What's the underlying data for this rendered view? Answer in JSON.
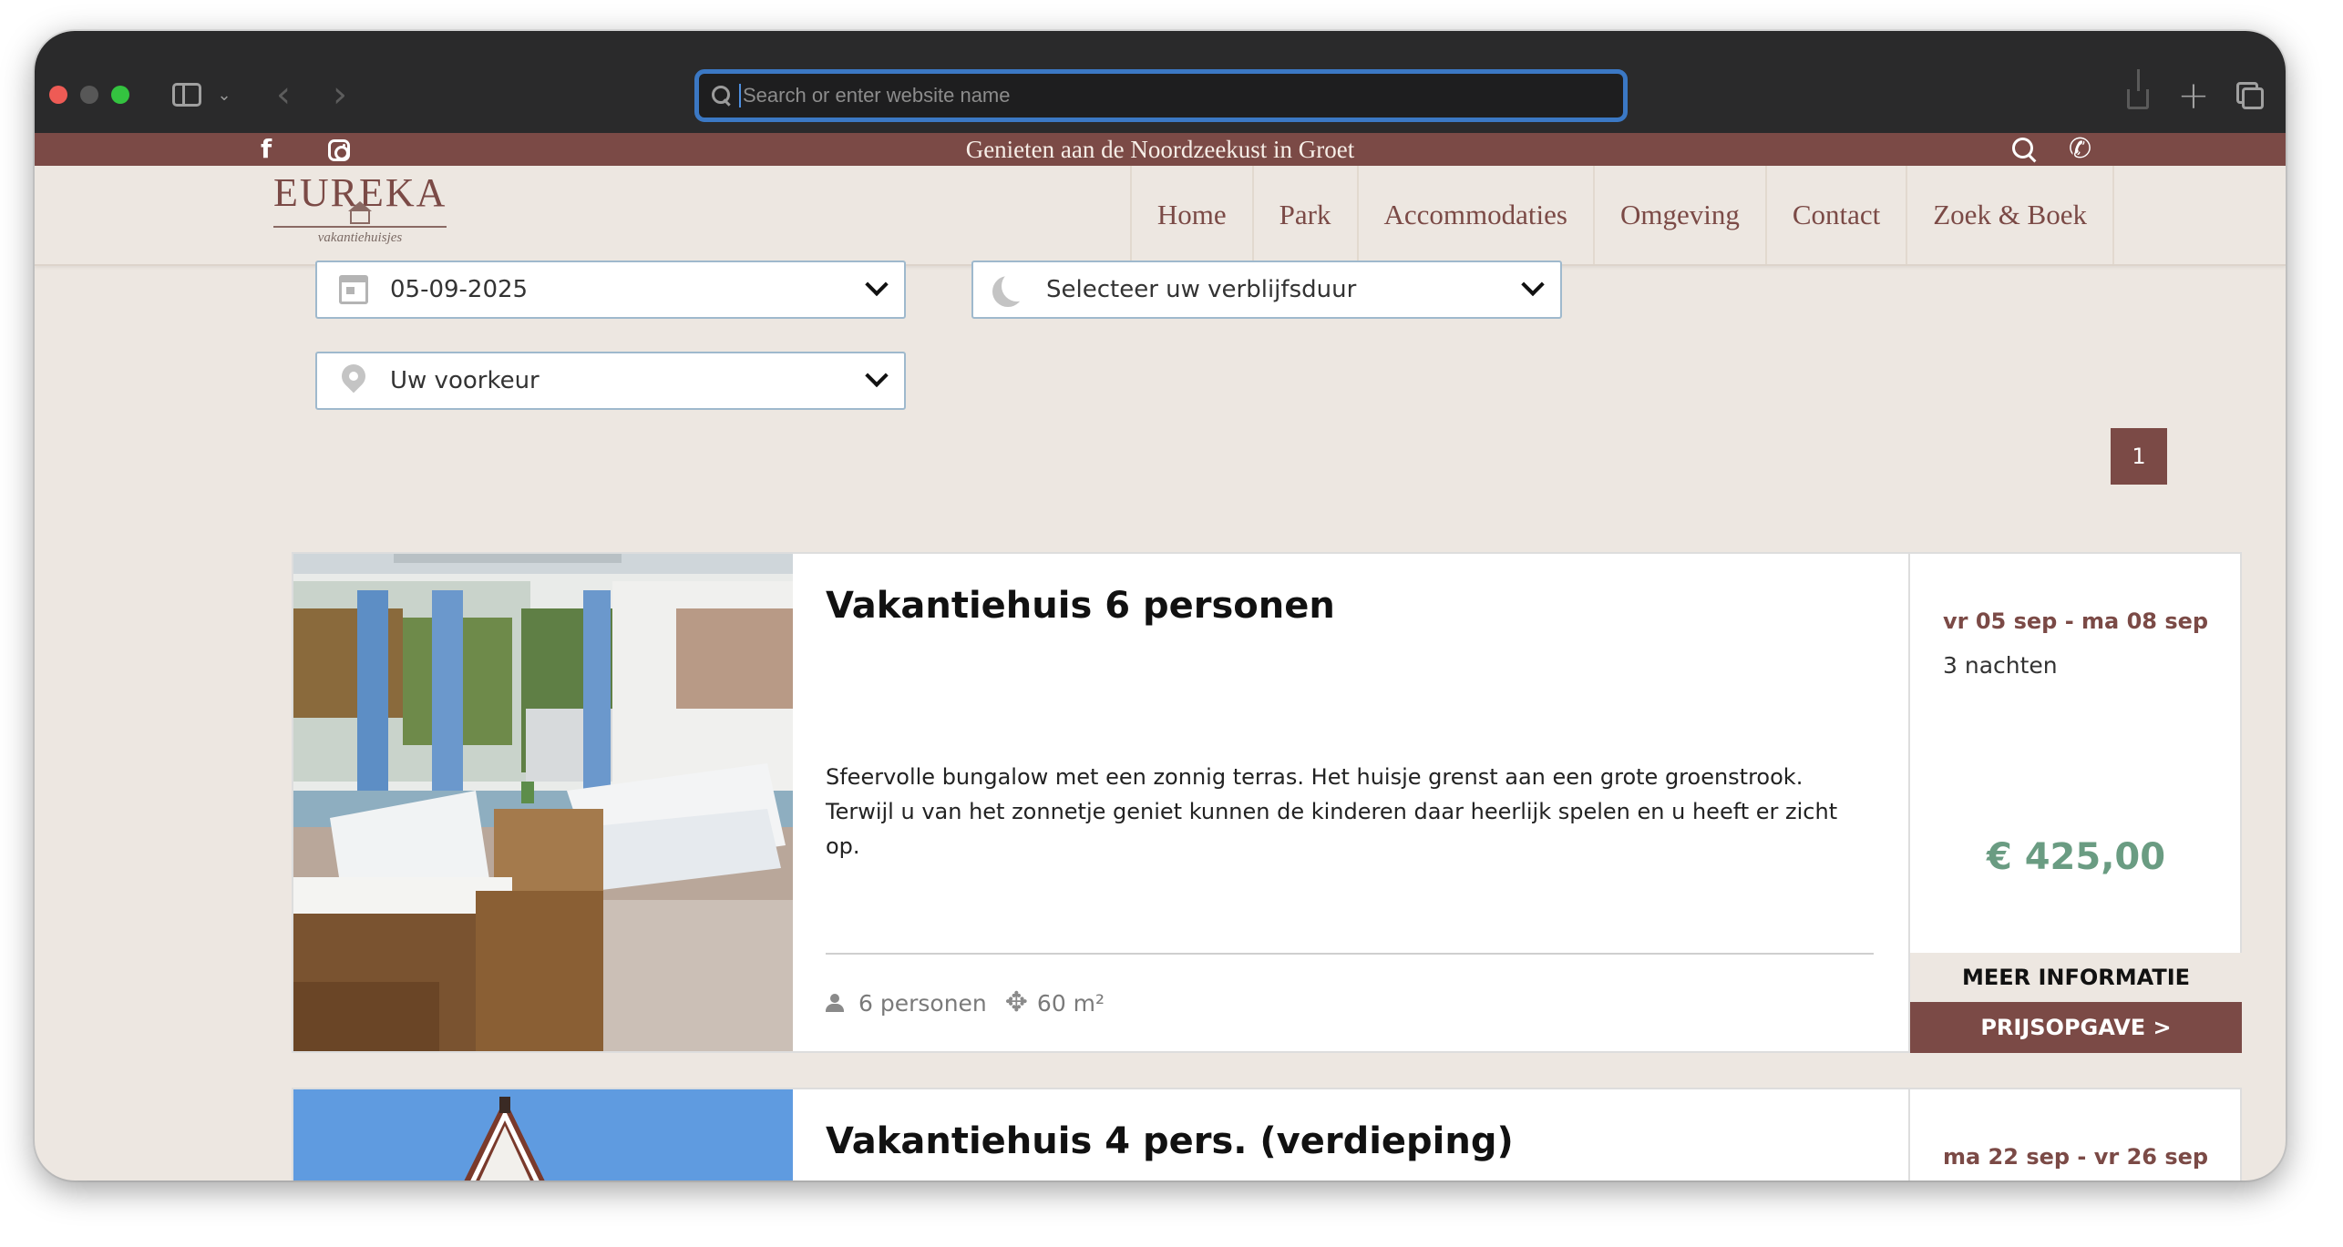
{
  "browser": {
    "address_placeholder": "Search or enter website name"
  },
  "topbar": {
    "tagline": "Genieten aan de Noordzeekust in Groet",
    "facebook_icon": "f"
  },
  "logo": {
    "name": "EUREKA",
    "subtitle": "vakantiehuisjes"
  },
  "nav": {
    "items": [
      "Home",
      "Park",
      "Accommodaties",
      "Omgeving",
      "Contact",
      "Zoek & Boek"
    ]
  },
  "filters": {
    "date": "05-09-2025",
    "stay": "Selecteer uw verblijfsduur",
    "preference": "Uw voorkeur"
  },
  "pagination": {
    "current": "1"
  },
  "listings": [
    {
      "title": "Vakantiehuis 6 personen",
      "description": "Sfeervolle bungalow met een zonnig terras. Het huisje grenst aan een grote groenstrook. Terwijl u van het zonnetje geniet kunnen de kinderen daar heerlijk spelen en u heeft er zicht op.",
      "persons": "6 personen",
      "area": "60 m²",
      "dates": "vr 05 sep - ma 08 sep",
      "nights": "3 nachten",
      "price": "€ 425,00",
      "more_info": "MEER INFORMATIE",
      "quote": "PRIJSOPGAVE >"
    },
    {
      "title": "Vakantiehuis 4 pers. (verdieping)",
      "dates": "ma 22 sep - vr 26 sep"
    }
  ],
  "colors": {
    "brand": "#7b4a46",
    "background": "#ede7e1",
    "price": "#6a9c82",
    "address_focus": "#3b78c4"
  },
  "icons": {
    "phone": "✆",
    "area": "✥"
  }
}
